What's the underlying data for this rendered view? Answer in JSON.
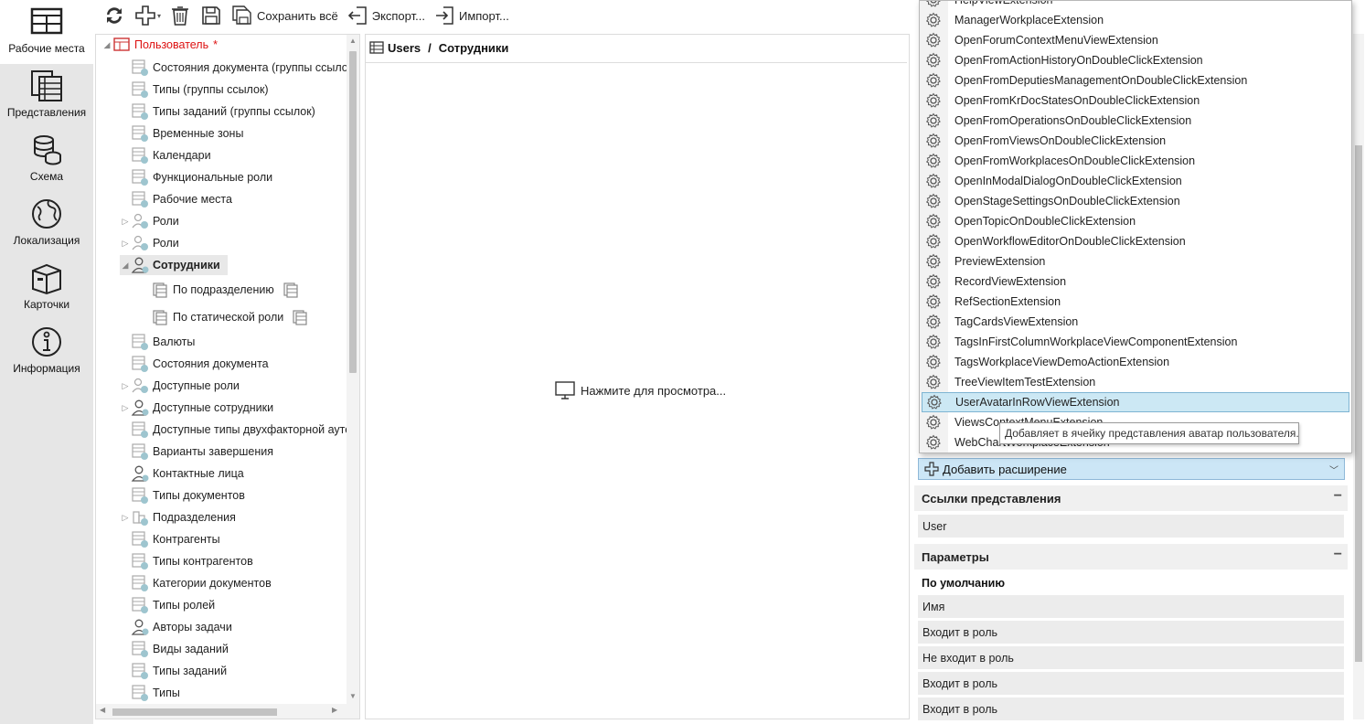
{
  "leftnav": {
    "items": [
      {
        "label": "Рабочие места",
        "icon": "workplaces-icon",
        "active": true
      },
      {
        "label": "Представления",
        "icon": "views-icon",
        "active": false
      },
      {
        "label": "Схема",
        "icon": "schema-icon",
        "active": false
      },
      {
        "label": "Локализация",
        "icon": "localization-icon",
        "active": false
      },
      {
        "label": "Карточки",
        "icon": "cards-icon",
        "active": false
      },
      {
        "label": "Информация",
        "icon": "info-icon",
        "active": false
      }
    ]
  },
  "toolbar": {
    "save_all_label": "Сохранить всё",
    "export_label": "Экспорт...",
    "import_label": "Импорт..."
  },
  "tree": {
    "items": [
      {
        "label": "Пользователь",
        "marker": "*",
        "arrow": "◢",
        "icon": "workplace-icon",
        "level": 0
      },
      {
        "label": "Состояния документа (группы ссылок)",
        "arrow": "",
        "icon": "view-icon",
        "level": 1
      },
      {
        "label": "Типы (группы ссылок)",
        "arrow": "",
        "icon": "view-icon",
        "level": 1
      },
      {
        "label": "Типы заданий (группы ссылок)",
        "arrow": "",
        "icon": "view-icon",
        "level": 1
      },
      {
        "label": "Временные зоны",
        "arrow": "",
        "icon": "view-icon",
        "level": 1
      },
      {
        "label": "Календари",
        "arrow": "",
        "icon": "view-icon",
        "level": 1
      },
      {
        "label": "Функциональные роли",
        "arrow": "",
        "icon": "view-icon",
        "level": 1
      },
      {
        "label": "Рабочие места",
        "arrow": "",
        "icon": "view-icon",
        "level": 1
      },
      {
        "label": "Роли",
        "arrow": "▷",
        "icon": "roles-icon",
        "level": 1
      },
      {
        "label": "Роли",
        "arrow": "▷",
        "icon": "roles-icon",
        "level": 1
      },
      {
        "label": "Сотрудники",
        "arrow": "◢",
        "icon": "user-icon",
        "level": 1,
        "selected": true
      },
      {
        "label": "По подразделению",
        "arrow": "",
        "icon": "subset-icon",
        "level": 2
      },
      {
        "label": "По статической роли",
        "arrow": "",
        "icon": "subset-icon",
        "level": 2
      },
      {
        "label": "Валюты",
        "arrow": "",
        "icon": "view-icon",
        "level": 1
      },
      {
        "label": "Состояния документа",
        "arrow": "",
        "icon": "view-icon",
        "level": 1
      },
      {
        "label": "Доступные роли",
        "arrow": "▷",
        "icon": "roles-icon",
        "level": 1
      },
      {
        "label": "Доступные сотрудники",
        "arrow": "▷",
        "icon": "user-icon",
        "level": 1
      },
      {
        "label": "Доступные типы двухфакторной аутентификации",
        "arrow": "",
        "icon": "view-icon",
        "level": 1
      },
      {
        "label": "Варианты завершения",
        "arrow": "",
        "icon": "view-icon",
        "level": 1
      },
      {
        "label": "Контактные лица",
        "arrow": "",
        "icon": "user-icon",
        "level": 1
      },
      {
        "label": "Типы документов",
        "arrow": "",
        "icon": "view-icon",
        "level": 1
      },
      {
        "label": "Подразделения",
        "arrow": "▷",
        "icon": "departments-icon",
        "level": 1
      },
      {
        "label": "Контрагенты",
        "arrow": "",
        "icon": "view-icon",
        "level": 1
      },
      {
        "label": "Типы контрагентов",
        "arrow": "",
        "icon": "view-icon",
        "level": 1
      },
      {
        "label": "Категории документов",
        "arrow": "",
        "icon": "view-icon",
        "level": 1
      },
      {
        "label": "Типы ролей",
        "arrow": "",
        "icon": "view-icon",
        "level": 1
      },
      {
        "label": "Авторы задачи",
        "arrow": "",
        "icon": "user-icon",
        "level": 1
      },
      {
        "label": "Виды заданий",
        "arrow": "",
        "icon": "view-icon",
        "level": 1
      },
      {
        "label": "Типы заданий",
        "arrow": "",
        "icon": "view-icon",
        "level": 1
      },
      {
        "label": "Типы",
        "arrow": "",
        "icon": "view-icon",
        "level": 1
      }
    ]
  },
  "center": {
    "breadcrumb": [
      "Users",
      "Сотрудники"
    ],
    "breadcrumb_sep": "/",
    "preview_text": "Нажмите для просмотра..."
  },
  "dropdown": {
    "partial_top": "HelpViewExtension",
    "items": [
      "ManagerWorkplaceExtension",
      "OpenForumContextMenuViewExtension",
      "OpenFromActionHistoryOnDoubleClickExtension",
      "OpenFromDeputiesManagementOnDoubleClickExtension",
      "OpenFromKrDocStatesOnDoubleClickExtension",
      "OpenFromOperationsOnDoubleClickExtension",
      "OpenFromViewsOnDoubleClickExtension",
      "OpenFromWorkplacesOnDoubleClickExtension",
      "OpenInModalDialogOnDoubleClickExtension",
      "OpenStageSettingsOnDoubleClickExtension",
      "OpenTopicOnDoubleClickExtension",
      "OpenWorkflowEditorOnDoubleClickExtension",
      "PreviewExtension",
      "RecordViewExtension",
      "RefSectionExtension",
      "TagCardsViewExtension",
      "TagsInFirstColumnWorkplaceViewComponentExtension",
      "TagsWorkplaceViewDemoActionExtension",
      "TreeViewItemTestExtension",
      "UserAvatarInRowViewExtension",
      "ViewsContextMenuExtension",
      "WebChartWorkplaceExtension"
    ],
    "highlighted": "UserAvatarInRowViewExtension",
    "tooltip": "Добавляет в ячейку представления аватар пользователя."
  },
  "right": {
    "add_extension_label": "Добавить расширение",
    "view_links_header": "Ссылки представления",
    "view_links": [
      "User"
    ],
    "params_header": "Параметры",
    "default_subheader": "По умолчанию",
    "params": [
      "Имя",
      "Входит в роль",
      "Не входит в роль",
      "Входит в роль",
      "Входит в роль"
    ],
    "collapse_glyph": "−"
  },
  "colors": {
    "accent": "#cce6f6",
    "highlight": "#cce8f4",
    "required": "#dd1111"
  }
}
